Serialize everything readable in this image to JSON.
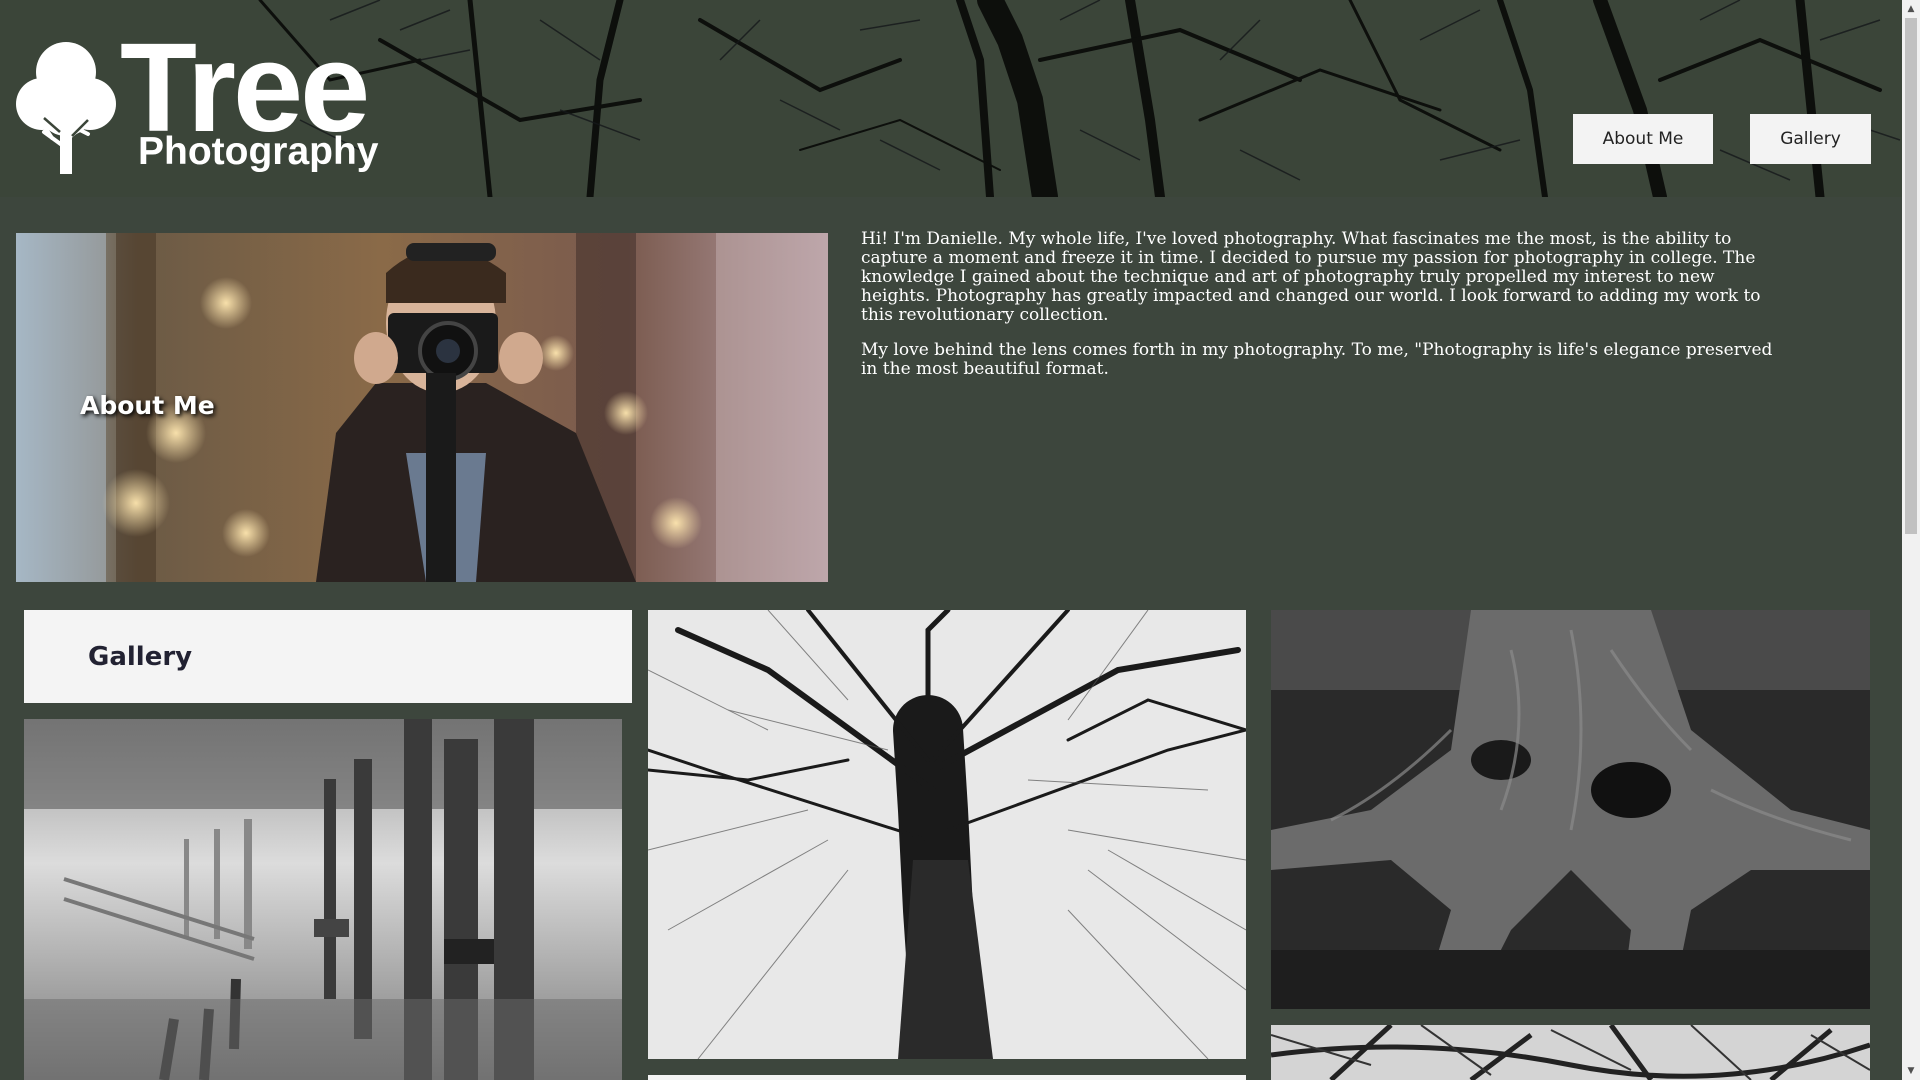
{
  "header": {
    "logo_main": "Tree",
    "logo_sub": "Photography",
    "nav": {
      "about_label": "About Me",
      "gallery_label": "Gallery"
    }
  },
  "about": {
    "title": "About Me",
    "paragraphs": [
      "Hi! I'm Danielle. My whole life, I've loved photography. What fascinates me the most, is the ability to capture a moment and freeze it in time. I decided to pursue my passion for photography in college. The knowledge I gained about the technique and art of photography truly propelled my interest to new heights. Photography has greatly impacted and changed our world. I look forward to adding my work to this revolutionary collection.",
      "My love behind the lens comes forth in my photography. To me, \"Photography is life's elegance preserved in the most beautiful format."
    ]
  },
  "gallery": {
    "title": "Gallery"
  },
  "colors": {
    "background": "#3d463d",
    "button_bg": "#f3f3f3",
    "text_light": "#ffffff"
  },
  "icons": {
    "scroll_up": "scroll-up-arrow-icon",
    "scroll_down": "scroll-down-arrow-icon",
    "logo": "tree-logo-icon"
  }
}
